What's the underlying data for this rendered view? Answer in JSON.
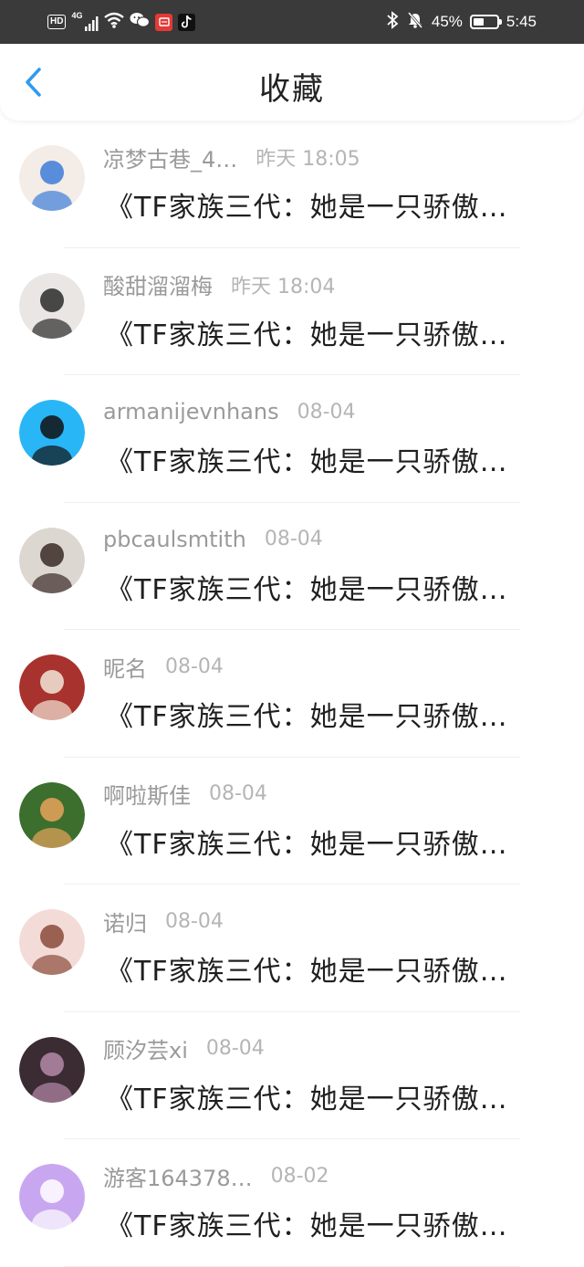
{
  "status_bar": {
    "hd": "HD",
    "network": "4G",
    "battery_text": "45%",
    "battery_level": 0.45,
    "time": "5:45"
  },
  "header": {
    "title": "收藏"
  },
  "items": [
    {
      "username": "凉梦古巷_4…",
      "date": "昨天 18:05",
      "title": "《TF家族三代：她是一只骄傲…",
      "avatar_color": "#f4ece6",
      "avatar_accent": "#3b7dd8"
    },
    {
      "username": "酸甜溜溜梅",
      "date": "昨天 18:04",
      "title": "《TF家族三代：她是一只骄傲…",
      "avatar_color": "#e9e6e3",
      "avatar_accent": "#2a2a2a"
    },
    {
      "username": "armanijevnhans",
      "date": "08-04",
      "title": "《TF家族三代：她是一只骄傲…",
      "avatar_color": "#29b6f6",
      "avatar_accent": "#111111"
    },
    {
      "username": "pbcaulsmtith",
      "date": "08-04",
      "title": "《TF家族三代：她是一只骄傲…",
      "avatar_color": "#ddd7d2",
      "avatar_accent": "#3a2a25"
    },
    {
      "username": "昵名",
      "date": "08-04",
      "title": "《TF家族三代：她是一只骄傲…",
      "avatar_color": "#a8322d",
      "avatar_accent": "#f2e6d8"
    },
    {
      "username": "啊啦斯佳",
      "date": "08-04",
      "title": "《TF家族三代：她是一只骄傲…",
      "avatar_color": "#3c6e2e",
      "avatar_accent": "#e7a35b"
    },
    {
      "username": "诺归",
      "date": "08-04",
      "title": "《TF家族三代：她是一只骄傲…",
      "avatar_color": "#f3dcd7",
      "avatar_accent": "#8a4b3c"
    },
    {
      "username": "顾汐芸xi",
      "date": "08-04",
      "title": "《TF家族三代：她是一只骄傲…",
      "avatar_color": "#3b2b33",
      "avatar_accent": "#b58aa8"
    },
    {
      "username": "游客164378…",
      "date": "08-02",
      "title": "《TF家族三代：她是一只骄傲…",
      "avatar_color": "#c9a7f0",
      "avatar_accent": "#ffffff"
    }
  ]
}
